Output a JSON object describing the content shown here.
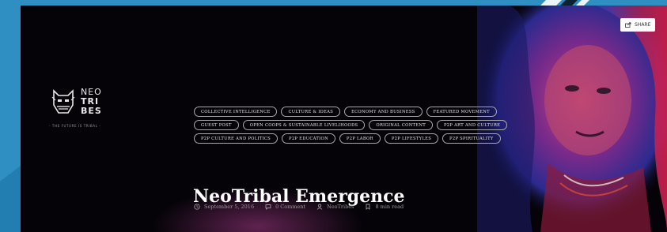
{
  "brand": {
    "line1": "NEO",
    "line2": "TRI",
    "line3": "BES",
    "tagline": "- THE FUTURE IS TRIBAL -"
  },
  "share": {
    "label": "SHARE"
  },
  "tags": [
    "Collective Intelligence",
    "Culture & Ideas",
    "Economy and Business",
    "Featured Movement",
    "Guest Post",
    "Open Coops & Sustainable Livelihoods",
    "Original Content",
    "P2P Art and Culture",
    "P2P Culture and Politics",
    "P2P Education",
    "P2P Labor",
    "P2P Lifestyles",
    "P2P Spirituality"
  ],
  "article": {
    "title": "NeoTribal Emergence",
    "date": "September 5, 2016",
    "comments": "0 Comment",
    "author": "NeoTribes",
    "read_time": "8 min read"
  },
  "icons": {
    "share": "share-icon",
    "date": "clock-icon",
    "comments": "comment-icon",
    "author": "user-icon",
    "read_time": "bookmark-icon"
  }
}
